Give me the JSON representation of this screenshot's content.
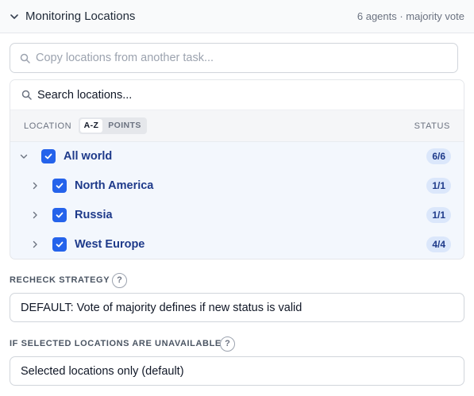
{
  "header": {
    "title": "Monitoring Locations",
    "meta": "6 agents · majority vote"
  },
  "copy_search": {
    "placeholder": "Copy locations from another task..."
  },
  "locations_panel": {
    "search_placeholder": "Search locations...",
    "column_location": "LOCATION",
    "sort_options": [
      "A-Z",
      "POINTS"
    ],
    "sort_selected": "A-Z",
    "column_status": "STATUS",
    "rows": [
      {
        "label": "All world",
        "status": "6/6",
        "checked": true,
        "expanded": true,
        "level": 0
      },
      {
        "label": "North America",
        "status": "1/1",
        "checked": true,
        "expanded": false,
        "level": 1
      },
      {
        "label": "Russia",
        "status": "1/1",
        "checked": true,
        "expanded": false,
        "level": 1
      },
      {
        "label": "West Europe",
        "status": "4/4",
        "checked": true,
        "expanded": false,
        "level": 1
      }
    ]
  },
  "recheck_strategy": {
    "label": "RECHECK STRATEGY",
    "help": "?",
    "value": "DEFAULT: Vote of majority defines if new status is valid"
  },
  "unavailable": {
    "label": "IF SELECTED LOCATIONS ARE UNAVAILABLE",
    "help": "?",
    "value": "Selected locations only (default)"
  },
  "colors": {
    "accent": "#2563eb",
    "row_text": "#1e3a8a",
    "selected_bg": "#f3f7fd"
  }
}
